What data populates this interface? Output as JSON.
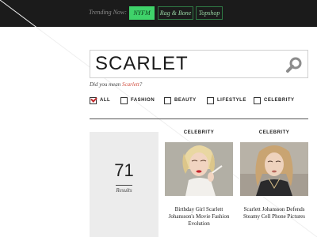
{
  "topbar": {
    "trending_label": "Trending Now:",
    "tags": [
      {
        "label": "NYFM",
        "active": true
      },
      {
        "label": "Rag & Bone",
        "active": false
      },
      {
        "label": "Topshop",
        "active": false
      }
    ]
  },
  "search": {
    "value": "SCARLET",
    "icon": "search-icon"
  },
  "suggestion": {
    "prefix": "Did you mean ",
    "term": "Scarlett",
    "suffix": "?"
  },
  "filters": [
    {
      "label": "ALL",
      "checked": true
    },
    {
      "label": "FASHION",
      "checked": false
    },
    {
      "label": "BEAUTY",
      "checked": false
    },
    {
      "label": "LIFESTYLE",
      "checked": false
    },
    {
      "label": "CELEBRITY",
      "checked": false
    }
  ],
  "results": {
    "count": "71",
    "label": "Results"
  },
  "cards": [
    {
      "category": "CELEBRITY",
      "title": "Birthday Girl Scarlett Johansson's Movie Fashion Evolution"
    },
    {
      "category": "CELEBRITY",
      "title": "Scarlett Johansson Defends Steamy Cell Phone Pictures"
    }
  ],
  "colors": {
    "topbar": "#1b1b1b",
    "active_tag": "#3fd36a",
    "tag_text": "#9ad9a6",
    "suggestion_link": "#d04a3a",
    "checkbox_check": "#c0282a",
    "count_panel": "#ececec"
  }
}
